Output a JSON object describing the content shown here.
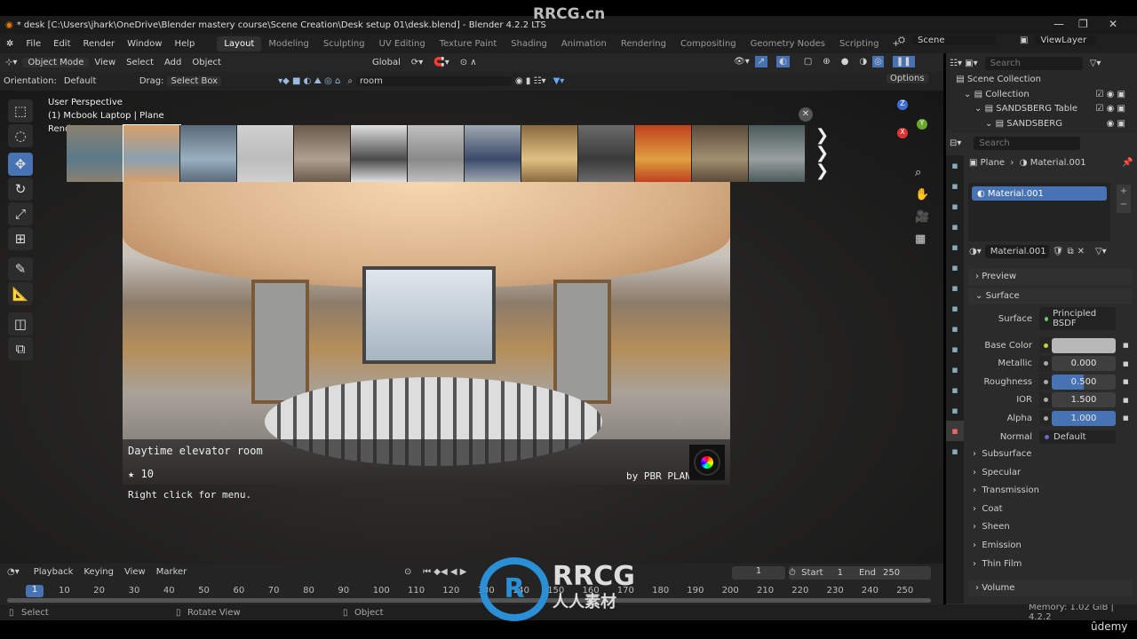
{
  "window": {
    "title": "* desk [C:\\Users\\jhark\\OneDrive\\Blender mastery course\\Scene Creation\\Desk setup 01\\desk.blend] - Blender 4.2.2 LTS",
    "minimize": "—",
    "maximize": "❐",
    "close": "✕"
  },
  "menu": [
    "File",
    "Edit",
    "Render",
    "Window",
    "Help"
  ],
  "workspaces": [
    "Layout",
    "Modeling",
    "Sculpting",
    "UV Editing",
    "Texture Paint",
    "Shading",
    "Animation",
    "Rendering",
    "Compositing",
    "Geometry Nodes",
    "Scripting"
  ],
  "active_workspace": "Layout",
  "add_workspace": "+",
  "scene": "Scene",
  "view_layer": "ViewLayer",
  "header": {
    "mode": "Object Mode",
    "view": "View",
    "select": "Select",
    "add": "Add",
    "object": "Object",
    "transform": "Global"
  },
  "tool_settings": {
    "orientation_label": "Orientation:",
    "orientation": "Default",
    "drag_label": "Drag:",
    "drag": "Select Box",
    "search_value": "room",
    "options": "Options"
  },
  "viewport": {
    "line1": "User Perspective",
    "line2": "(1) Mcbook Laptop | Plane",
    "line3": "Rend"
  },
  "asset_browser": {
    "thumb_colors": [
      [
        "#8a8070",
        "#5a7a8a"
      ],
      [
        "#d8a06a",
        "#8aa0b0"
      ],
      [
        "#5a6a7a",
        "#9ab0c0"
      ],
      [
        "#d0d0d0",
        "#bcbcbc"
      ],
      [
        "#6a5a4a",
        "#b0a090"
      ],
      [
        "#e0e0e0",
        "#4a4a4a"
      ],
      [
        "#c0c0c0",
        "#888"
      ],
      [
        "#a0a8b0",
        "#3a4a6a"
      ],
      [
        "#8a6a40",
        "#e0c080"
      ],
      [
        "#6a6a6a",
        "#3a3a3a"
      ],
      [
        "#c04020",
        "#e0a040"
      ],
      [
        "#5a4a3a",
        "#a09070"
      ],
      [
        "#4a5a5a",
        "#9aa0a0"
      ]
    ],
    "title": "Daytime elevator room",
    "rating": "10",
    "author": "by PBR PLAN",
    "hint": "Right click for menu.",
    "close": "✕",
    "next": "❯"
  },
  "timeline": {
    "menus": [
      "Playback",
      "Keying",
      "View",
      "Marker"
    ],
    "current_frame": "1",
    "start_label": "Start",
    "start": "1",
    "end_label": "End",
    "end": "250",
    "ticks": [
      "10",
      "20",
      "30",
      "40",
      "50",
      "60",
      "70",
      "80",
      "90",
      "100",
      "110",
      "120",
      "130",
      "140",
      "150",
      "160",
      "170",
      "180",
      "190",
      "200",
      "210",
      "220",
      "230",
      "240",
      "250"
    ]
  },
  "status": {
    "select": "Select",
    "rotate": "Rotate View",
    "object": "Object",
    "memory": "Memory: 1.02 GiB | 4.2.2"
  },
  "outliner": {
    "search_placeholder": "Search",
    "items": [
      {
        "label": "Scene Collection",
        "depth": 0
      },
      {
        "label": "Collection",
        "depth": 1
      },
      {
        "label": "SANDSBERG Table",
        "depth": 2
      },
      {
        "label": "SANDSBERG",
        "depth": 3
      }
    ]
  },
  "properties": {
    "search_placeholder": "Search",
    "object": "Plane",
    "material": "Material.001",
    "slot": "Material.001",
    "material_name": "Material.001",
    "panels": {
      "preview": "Preview",
      "surface": "Surface"
    },
    "surface_label": "Surface",
    "surface_value": "Principled BSDF",
    "fields": [
      {
        "label": "Base Color",
        "value": "",
        "color": "#b8b8b8",
        "fill": 0
      },
      {
        "label": "Metallic",
        "value": "0.000",
        "fill": 0
      },
      {
        "label": "Roughness",
        "value": "0.500",
        "fill": 0.5
      },
      {
        "label": "IOR",
        "value": "1.500",
        "fill": 0
      },
      {
        "label": "Alpha",
        "value": "1.000",
        "fill": 1
      }
    ],
    "normal_label": "Normal",
    "normal_value": "Default",
    "subpanels": [
      "Subsurface",
      "Specular",
      "Transmission",
      "Coat",
      "Sheen",
      "Emission",
      "Thin Film"
    ],
    "volume": "Volume"
  },
  "watermarks": {
    "top": "RRCG.cn",
    "logo": "RRCG",
    "logo_cn": "人人素材",
    "udemy": "ûdemy"
  },
  "colors": {
    "accent": "#4772b3",
    "active_tab": "#303030"
  }
}
